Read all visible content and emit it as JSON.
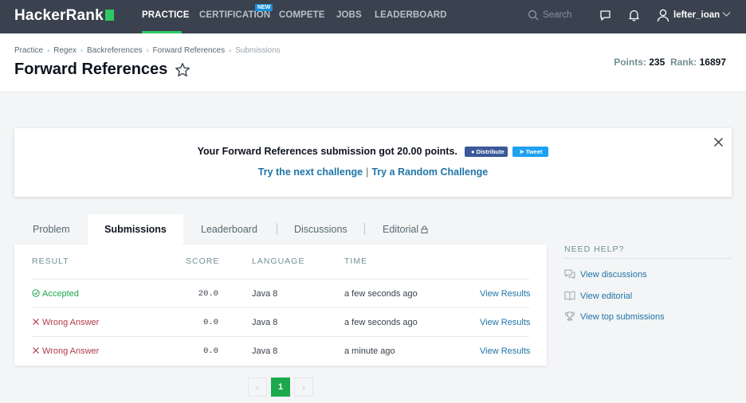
{
  "nav": {
    "logo": "HackerRank",
    "items": [
      "PRACTICE",
      "CERTIFICATION",
      "COMPETE",
      "JOBS",
      "LEADERBOARD"
    ],
    "new_badge": "NEW",
    "search_placeholder": "Search",
    "username": "lefter_ioan"
  },
  "header": {
    "breadcrumb": [
      "Practice",
      "Regex",
      "Backreferences",
      "Forward References",
      "Submissions"
    ],
    "title": "Forward References",
    "points_label": "Points:",
    "points_value": "235",
    "rank_label": "Rank:",
    "rank_value": "16897"
  },
  "banner": {
    "message": "Your Forward References submission got 20.00 points.",
    "share_fb": "Distribute",
    "share_tw": "Tweet",
    "next_link": "Try the next challenge",
    "separator": "|",
    "random_link": "Try a Random Challenge"
  },
  "tabs": [
    "Problem",
    "Submissions",
    "Leaderboard",
    "Discussions",
    "Editorial"
  ],
  "table": {
    "headers": [
      "RESULT",
      "SCORE",
      "LANGUAGE",
      "TIME"
    ],
    "rows": [
      {
        "result": "Accepted",
        "score": "20.0",
        "language": "Java 8",
        "time": "a few seconds ago",
        "action": "View Results"
      },
      {
        "result": "Wrong Answer",
        "score": "0.0",
        "language": "Java 8",
        "time": "a few seconds ago",
        "action": "View Results"
      },
      {
        "result": "Wrong Answer",
        "score": "0.0",
        "language": "Java 8",
        "time": "a minute ago",
        "action": "View Results"
      }
    ]
  },
  "help": {
    "title": "NEED HELP?",
    "links": [
      "View discussions",
      "View editorial",
      "View top submissions"
    ]
  },
  "pagination": {
    "prev": "‹",
    "current": "1",
    "next": "›"
  },
  "colors": {
    "nav_bg": "#39424e",
    "accent_green": "#1ba94c",
    "link_blue": "#1f74a8",
    "error_red": "#b23a48"
  }
}
